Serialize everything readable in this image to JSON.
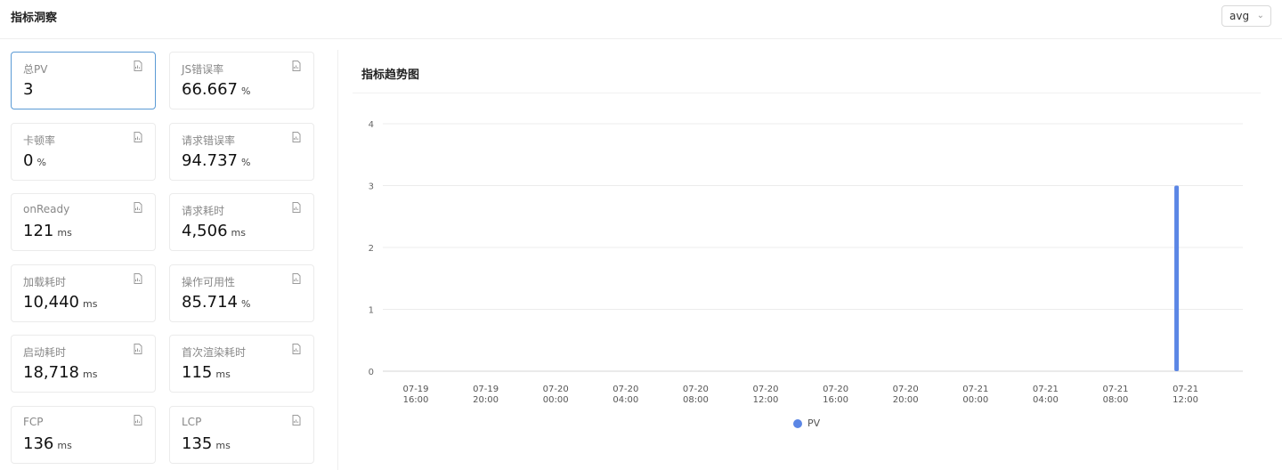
{
  "header": {
    "title": "指标洞察",
    "aggregate_select": "avg"
  },
  "metrics": [
    {
      "label": "总PV",
      "value": "3",
      "unit": ""
    },
    {
      "label": "JS错误率",
      "value": "66.667",
      "unit": "%"
    },
    {
      "label": "卡顿率",
      "value": "0",
      "unit": "%"
    },
    {
      "label": "请求错误率",
      "value": "94.737",
      "unit": "%"
    },
    {
      "label": "onReady",
      "value": "121",
      "unit": "ms"
    },
    {
      "label": "请求耗时",
      "value": "4,506",
      "unit": "ms"
    },
    {
      "label": "加载耗时",
      "value": "10,440",
      "unit": "ms"
    },
    {
      "label": "操作可用性",
      "value": "85.714",
      "unit": "%"
    },
    {
      "label": "启动耗时",
      "value": "18,718",
      "unit": "ms"
    },
    {
      "label": "首次渲染耗时",
      "value": "115",
      "unit": "ms"
    },
    {
      "label": "FCP",
      "value": "136",
      "unit": "ms"
    },
    {
      "label": "LCP",
      "value": "135",
      "unit": "ms"
    }
  ],
  "trend": {
    "title": "指标趋势图",
    "legend_label": "PV"
  },
  "chart_data": {
    "type": "bar",
    "categories": [
      [
        "07-19",
        "16:00"
      ],
      [
        "07-19",
        "20:00"
      ],
      [
        "07-20",
        "00:00"
      ],
      [
        "07-20",
        "04:00"
      ],
      [
        "07-20",
        "08:00"
      ],
      [
        "07-20",
        "12:00"
      ],
      [
        "07-20",
        "16:00"
      ],
      [
        "07-20",
        "20:00"
      ],
      [
        "07-21",
        "00:00"
      ],
      [
        "07-21",
        "04:00"
      ],
      [
        "07-21",
        "08:00"
      ],
      [
        "07-21",
        "12:00"
      ]
    ],
    "series": [
      {
        "name": "PV",
        "color": "#5b86e5",
        "values": [
          0,
          0,
          0,
          0,
          0,
          0,
          0,
          0,
          0,
          0,
          0,
          3
        ]
      }
    ],
    "yticks": [
      0,
      1,
      2,
      3,
      4
    ],
    "ylim": [
      0,
      4
    ],
    "grid": true,
    "legend": "bottom-center"
  }
}
